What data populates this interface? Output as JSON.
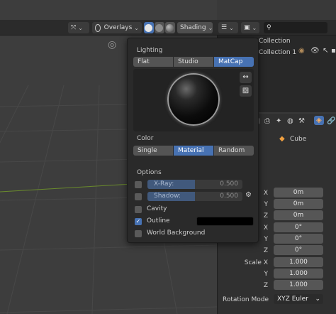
{
  "header": {
    "overlays_label": "Overlays",
    "shading_label": "Shading",
    "search_icon": "search-icon"
  },
  "outliner": {
    "collection_label": "Collection",
    "collection1_label": "Collection 1"
  },
  "popover": {
    "lighting": {
      "title": "Lighting",
      "options": [
        "Flat",
        "Studio",
        "MatCap"
      ],
      "selected": "MatCap"
    },
    "color": {
      "title": "Color",
      "options": [
        "Single",
        "Material",
        "Random"
      ],
      "selected": "Material"
    },
    "options": {
      "title": "Options",
      "xray": {
        "label": "X-Ray:",
        "value": "0.500",
        "level": 0.5
      },
      "shadow": {
        "label": "Shadow:",
        "value": "0.500",
        "level": 0.5
      },
      "cavity_label": "Cavity",
      "outline_label": "Outline",
      "outline_color": "#000000",
      "world_bg_label": "World Background"
    }
  },
  "properties": {
    "object_name": "Cube",
    "location": {
      "x_label": "X",
      "y_label": "Y",
      "z_label": "Z",
      "x": "0m",
      "y": "0m",
      "z": "0m"
    },
    "rotation": {
      "x_label": "X",
      "y_label": "Y",
      "z_label": "Z",
      "x": "0°",
      "y": "0°",
      "z": "0°"
    },
    "scale": {
      "x_label": "Scale X",
      "y_label": "Y",
      "z_label": "Z",
      "x": "1.000",
      "y": "1.000",
      "z": "1.000"
    },
    "rotation_mode_label": "Rotation Mode",
    "rotation_mode_value": "XYZ Euler"
  },
  "colors": {
    "accent": "#4772b3",
    "viewport_bg": "#3d3d3d",
    "panel_bg": "#2a2a2a"
  }
}
